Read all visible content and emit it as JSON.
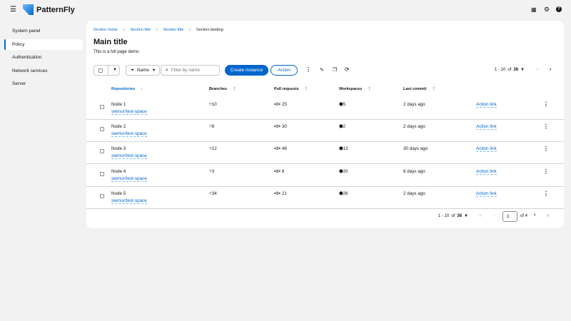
{
  "header": {
    "brand": "PatternFly",
    "icons": [
      "hamburger-icon",
      "grid-icon",
      "gear-icon",
      "help-icon"
    ]
  },
  "sidebar": {
    "items": [
      {
        "label": "System panel"
      },
      {
        "label": "Policy",
        "selected": true
      },
      {
        "label": "Authentication"
      },
      {
        "label": "Network services"
      },
      {
        "label": "Server"
      }
    ]
  },
  "breadcrumb": [
    "Section home",
    "Section title",
    "Section title",
    "Section landing"
  ],
  "page": {
    "title": "Main title",
    "description": "This is a full page demo."
  },
  "toolbar": {
    "filter_label": "Name",
    "search_placeholder": "Filter by name",
    "create_label": "Create instance",
    "action_label": "Action",
    "pagination": {
      "range": "1 - 10",
      "of": "of",
      "total": "36"
    }
  },
  "table": {
    "columns": [
      "Repositories",
      "Branches",
      "Pull requests",
      "Workspaces",
      "Last commit"
    ],
    "rows": [
      {
        "name": "Node 1",
        "repo": "siemur/test-space",
        "branches": "10",
        "prs": "25",
        "workspaces": "5",
        "last": "2 days ago",
        "action": "Action link"
      },
      {
        "name": "Node 2",
        "repo": "siemur/test-space",
        "branches": "8",
        "prs": "30",
        "workspaces": "2",
        "last": "2 days ago",
        "action": "Action link"
      },
      {
        "name": "Node 3",
        "repo": "siemur/test-space",
        "branches": "12",
        "prs": "48",
        "workspaces": "13",
        "last": "30 days ago",
        "action": "Action link"
      },
      {
        "name": "Node 4",
        "repo": "siemur/test-space",
        "branches": "3",
        "prs": "8",
        "workspaces": "20",
        "last": "8 days ago",
        "action": "Action link"
      },
      {
        "name": "Node 5",
        "repo": "siemur/test-space",
        "branches": "34",
        "prs": "21",
        "workspaces": "26",
        "last": "2 days ago",
        "action": "Action link"
      }
    ]
  },
  "footer": {
    "range": "1 - 10",
    "of": "of",
    "total": "36",
    "page": "1",
    "of_pages": "of 4"
  },
  "colors": {
    "accent": "#0066cc",
    "background": "#f2f2f2"
  }
}
